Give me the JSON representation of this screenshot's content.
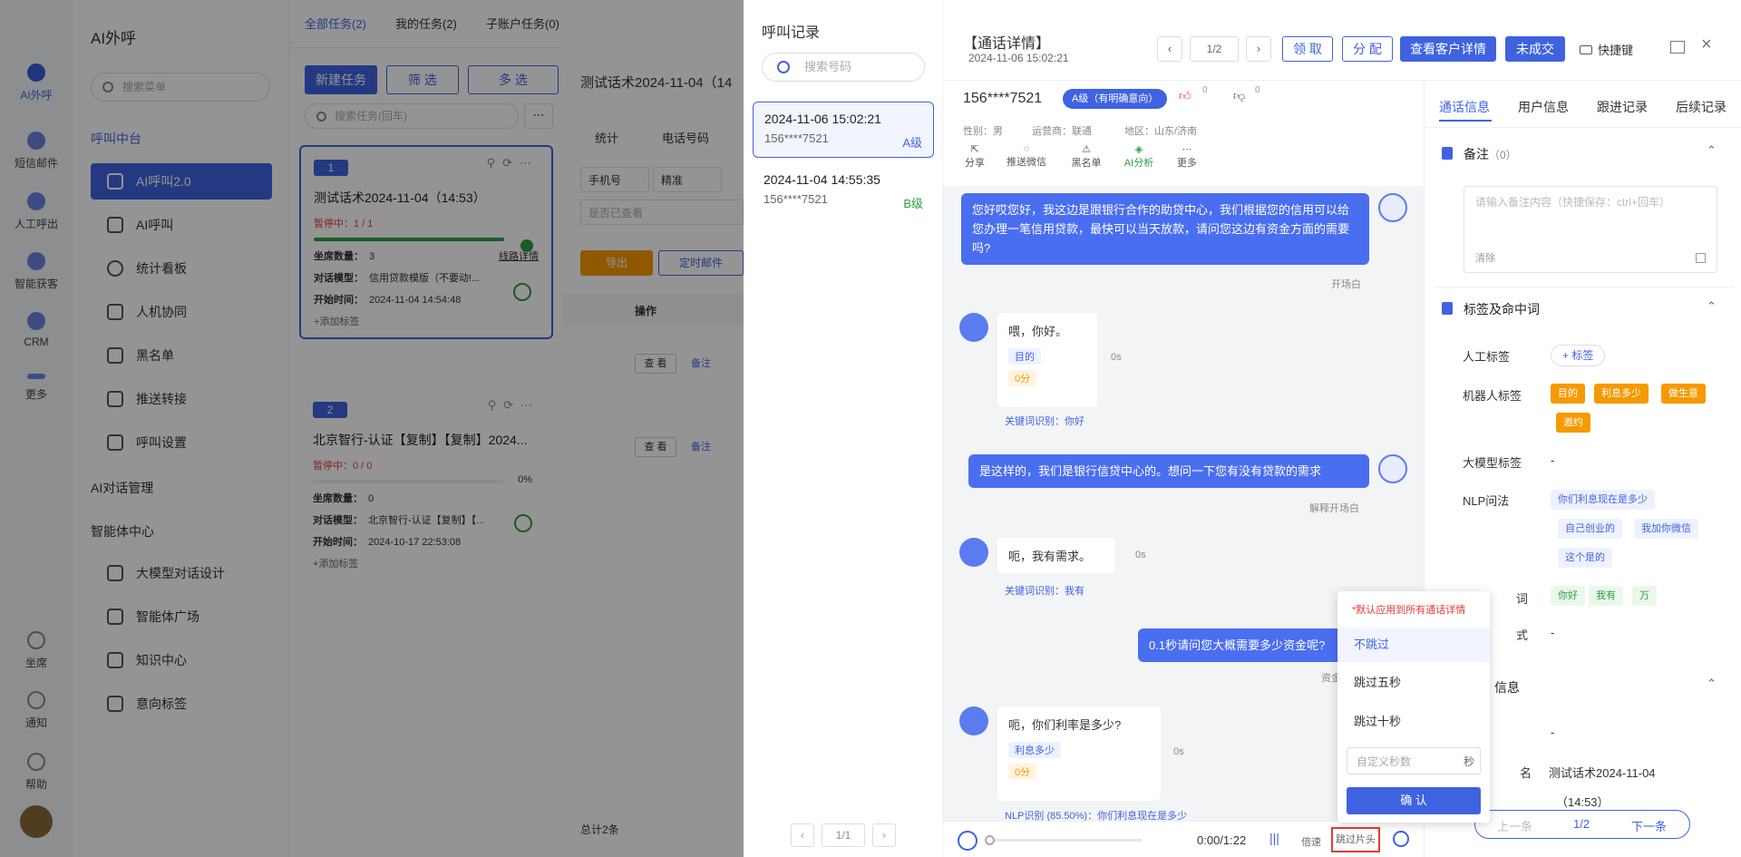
{
  "rail": {
    "items": [
      {
        "label": "AI外呼",
        "icon": "robot-icon"
      },
      {
        "label": "短信邮件",
        "icon": "message-icon"
      },
      {
        "label": "人工呼出",
        "icon": "headset-icon"
      },
      {
        "label": "智能获客",
        "icon": "target-icon"
      },
      {
        "label": "CRM",
        "icon": "crm-icon"
      },
      {
        "label": "更多",
        "icon": "more-icon"
      }
    ],
    "bottom": [
      {
        "label": "坐席",
        "icon": "headset-icon"
      },
      {
        "label": "通知",
        "icon": "bell-icon"
      },
      {
        "label": "帮助",
        "icon": "help-icon"
      }
    ]
  },
  "sidebar": {
    "title": "AI外呼",
    "search_placeholder": "搜索菜单",
    "group1": "呼叫中台",
    "items": [
      "AI呼叫2.0",
      "AI呼叫",
      "统计看板",
      "人机协同",
      "黑名单",
      "推送转接",
      "呼叫设置"
    ],
    "group2": "AI对话管理",
    "group3": "智能体中心",
    "items2": [
      "大模型对话设计",
      "智能体广场",
      "知识中心",
      "意向标签"
    ]
  },
  "tasks": {
    "tabs": [
      "全部任务(2)",
      "我的任务(2)",
      "子账户任务(0)"
    ],
    "new_btn": "新建任务",
    "filter_btn": "筛 选",
    "multi_btn": "多 选",
    "search_placeholder": "搜索任务(回车)",
    "cards": [
      {
        "no": "1",
        "title": "测试话术2024-11-04（14:53）",
        "status": "暂停中：1 / 1",
        "seats": "3",
        "model": "信用贷款模版（不要动!...",
        "start": "2024-11-04 14:54:48",
        "link": "线路详情",
        "progress": 1.0,
        "add": "+添加标签"
      },
      {
        "no": "2",
        "title": "北京智行-认证【复制】【复制】2024...",
        "status": "暂停中：0 / 0",
        "seats": "0",
        "model": "北京智行-认证【复制】【...",
        "start": "2024-10-17 22:53:08",
        "pct": "0%",
        "progress": 0,
        "add": "+添加标签"
      }
    ],
    "labels": {
      "seats": "坐席数量：",
      "model": "对话模型：",
      "start": "开始时间："
    }
  },
  "table": {
    "title": "测试话术2024-11-04（14",
    "tabs": [
      "统计",
      "电话号码"
    ],
    "sel1": "手机号",
    "sel2": "精准",
    "placeholder": "是否已查看",
    "export": "导出",
    "timer": "定时邮件",
    "col_op": "操作",
    "view": "查 看",
    "note": "备注",
    "total": "总计2条"
  },
  "records": {
    "title": "呼叫记录",
    "search_placeholder": "搜索号码",
    "items": [
      {
        "time": "2024-11-06 15:02:21",
        "phone": "156****7521",
        "level": "A级"
      },
      {
        "time": "2024-11-04 14:55:35",
        "phone": "156****7521",
        "level": "B级"
      }
    ],
    "pager": "1/1"
  },
  "detail": {
    "title": "【通话详情】",
    "time": "2024-11-06 15:02:21",
    "pager": "1/2",
    "btn_claim": "领 取",
    "btn_assign": "分 配",
    "btn_customer": "查看客户详情",
    "btn_deal": "未成交",
    "btn_quick": "快捷键",
    "phone": "156****7521",
    "level": "A级（有明确意向）",
    "likes": "0",
    "dislikes": "0",
    "meta": [
      "性别：男",
      "运营商：联通",
      "地区：山东/济南"
    ],
    "actions": [
      "分享",
      "推送微信",
      "黑名单",
      "AI分析",
      "更多"
    ]
  },
  "convo": {
    "msg1": "您好哎您好，我这边是跟银行合作的助贷中心，我们根据您的信用可以给您办理一笔信用贷款，最快可以当天放款，请问您这边有资金方面的需要吗?",
    "cap1": "开场白",
    "msg2": "喂，你好。",
    "msg2_tag": "目的",
    "msg2_score": "0分",
    "msg2_time": "0s",
    "msg2_kw": "关键词识别：你好",
    "msg3": "是这样的，我们是银行信贷中心的。想问一下您有没有贷款的需求",
    "cap3": "解释开场白",
    "msg4": "呃，我有需求。",
    "msg4_time": "0s",
    "msg4_kw": "关键词识别：我有",
    "msg5": "0.1秒请问您大概需要多少资金呢?",
    "cap5": "资金",
    "msg6": "呃，你们利率是多少?",
    "msg6_tag": "利息多少",
    "msg6_score": "0分",
    "msg6_time": "0s",
    "msg6_kw": "NLP识别 (85.50%)：你们利息现在是多少"
  },
  "player": {
    "time": "0:00/1:22",
    "speed": "倍速",
    "skip": "跳过片头"
  },
  "popup": {
    "note": "*默认应用到所有通话详情",
    "opts": [
      "不跳过",
      "跳过五秒",
      "跳过十秒"
    ],
    "custom_placeholder": "自定义秒数",
    "unit": "秒",
    "confirm": "确 认"
  },
  "rpanel": {
    "tabs": [
      "通话信息",
      "用户信息",
      "跟进记录",
      "后续记录"
    ],
    "note_title": "备注",
    "note_count": "（0）",
    "note_placeholder": "请输入备注内容（快捷保存：ctrl+回车）",
    "clear": "清除",
    "tags_title": "标签及命中词",
    "manual": "人工标签",
    "add_tag": "+ 标签",
    "robot": "机器人标签",
    "robot_tags": [
      "目的",
      "利息多少",
      "做生意",
      "邀约"
    ],
    "llm": "大模型标签",
    "llm_val": "-",
    "nlp": "NLP问法",
    "nlp_tags": [
      "你们利息现在是多少",
      "自己创业的",
      "我加你微信",
      "这个是的"
    ],
    "kw": "词",
    "kw_tags": [
      "你好",
      "我有",
      "万"
    ],
    "regex": "式",
    "regex_val": "-",
    "info_title": "信息",
    "info_dash": "-",
    "name_lbl": "名",
    "name_val": "测试话术2024-11-04",
    "name_val2": "（14:53）",
    "prev": "上一条",
    "page": "1/2",
    "next": "下一条"
  }
}
